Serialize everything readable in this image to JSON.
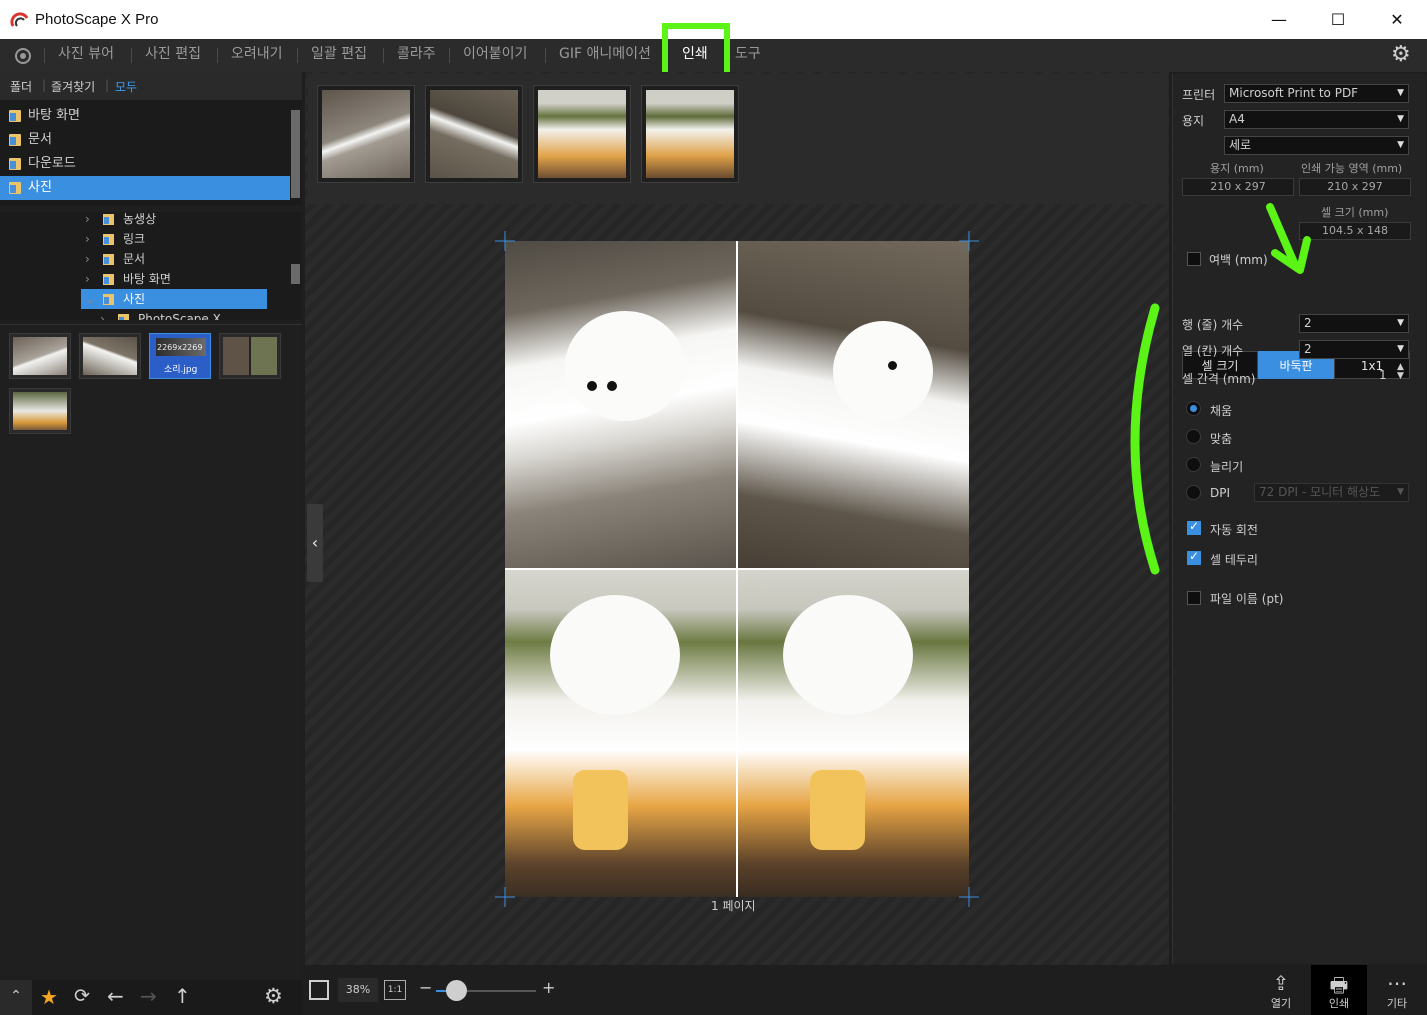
{
  "window": {
    "title": "PhotoScape X Pro"
  },
  "menu": {
    "items": [
      "사진 뷰어",
      "사진 편집",
      "오려내기",
      "일괄 편집",
      "콜라주",
      "이어붙이기",
      "GIF 애니메이션",
      "인쇄",
      "도구"
    ]
  },
  "left": {
    "tabs": [
      "폴더",
      "즐겨찾기",
      "모두"
    ],
    "favorites": [
      "바탕 화면",
      "문서",
      "다운로드",
      "사진"
    ],
    "tree": [
      "농생상",
      "링크",
      "문서",
      "바탕 화면",
      "사진",
      "PhotoScape X"
    ],
    "selected_thumb": {
      "name": "소리.jpg",
      "size": "2269x2269"
    }
  },
  "center": {
    "page_label": "1 페이지",
    "zoom": "38%",
    "zoom_1to1": "1:1"
  },
  "right": {
    "printer_label": "프린터",
    "printer_value": "Microsoft Print to PDF",
    "paper_label": "용지",
    "paper_value": "A4",
    "orientation_value": "세로",
    "paper_mm_label": "용지 (mm)",
    "printable_label": "인쇄 가능 영역 (mm)",
    "paper_mm_value": "210 x 297",
    "printable_value": "210 x 297",
    "cell_size_label": "셀 크기 (mm)",
    "cell_size_value": "104.5 x 148",
    "margin_label": "여백 (mm)",
    "seg_cell": "셀 크기",
    "seg_grid": "바둑판",
    "seg_1x1": "1x1",
    "rows_label": "행 (줄) 개수",
    "rows_value": "2",
    "cols_label": "열 (칸) 개수",
    "cols_value": "2",
    "gap_label": "셀 간격 (mm)",
    "gap_value": "1",
    "fit_options": [
      "채움",
      "맞춤",
      "늘리기",
      "DPI"
    ],
    "dpi_value": "72 DPI - 모니터 해상도",
    "auto_rotate": "자동 회전",
    "cell_border": "셀 테두리",
    "filename": "파일 이름 (pt)"
  },
  "bottom": {
    "open": "열기",
    "print": "인쇄",
    "more": "기타"
  },
  "colors": {
    "accent": "#3b8fe0",
    "highlight": "#5cf316"
  }
}
